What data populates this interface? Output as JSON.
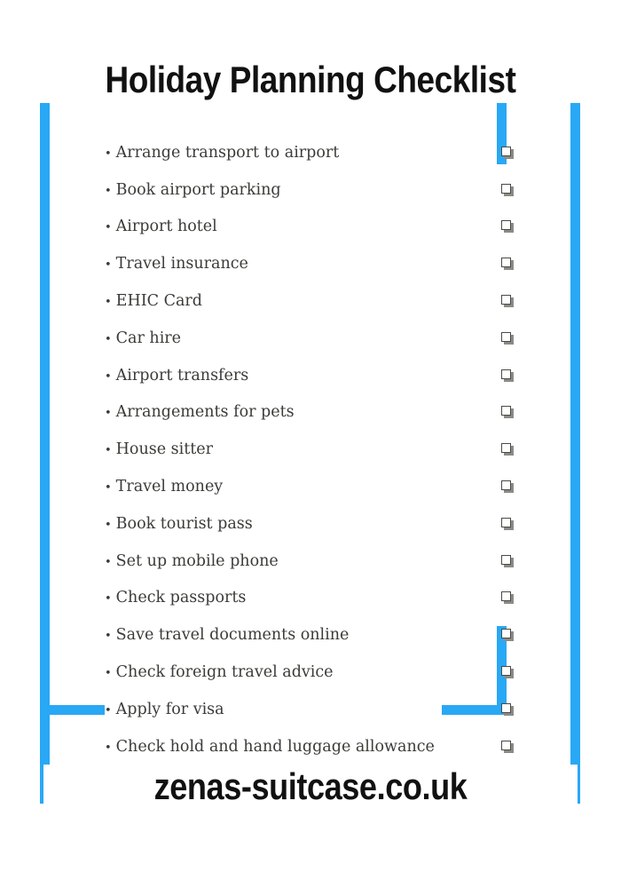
{
  "document": {
    "title": "Holiday Planning Checklist",
    "footer_url": "zenas-suitcase.co.uk",
    "background_color": "#ffffff",
    "frame_color": "#29a8f5",
    "text_color": "#3b3b36",
    "heading_color": "#111111"
  },
  "checklist": {
    "bullet_glyph": "•",
    "checkbox_glyph": "❑",
    "items": [
      {
        "label": "Arrange transport to airport",
        "checked": false
      },
      {
        "label": "Book airport parking",
        "checked": false
      },
      {
        "label": "Airport hotel",
        "checked": false
      },
      {
        "label": "Travel insurance",
        "checked": false
      },
      {
        "label": "EHIC Card",
        "checked": false
      },
      {
        "label": "Car hire",
        "checked": false
      },
      {
        "label": "Airport transfers",
        "checked": false
      },
      {
        "label": "Arrangements for pets",
        "checked": false
      },
      {
        "label": "House sitter",
        "checked": false
      },
      {
        "label": "Travel money",
        "checked": false
      },
      {
        "label": "Book tourist pass",
        "checked": false
      },
      {
        "label": "Set up mobile phone",
        "checked": false
      },
      {
        "label": "Check passports",
        "checked": false
      },
      {
        "label": "Save travel documents online",
        "checked": false
      },
      {
        "label": "Check foreign travel advice",
        "checked": false
      },
      {
        "label": "Apply for visa",
        "checked": false
      },
      {
        "label": "Check hold and hand luggage allowance",
        "checked": false
      }
    ]
  }
}
